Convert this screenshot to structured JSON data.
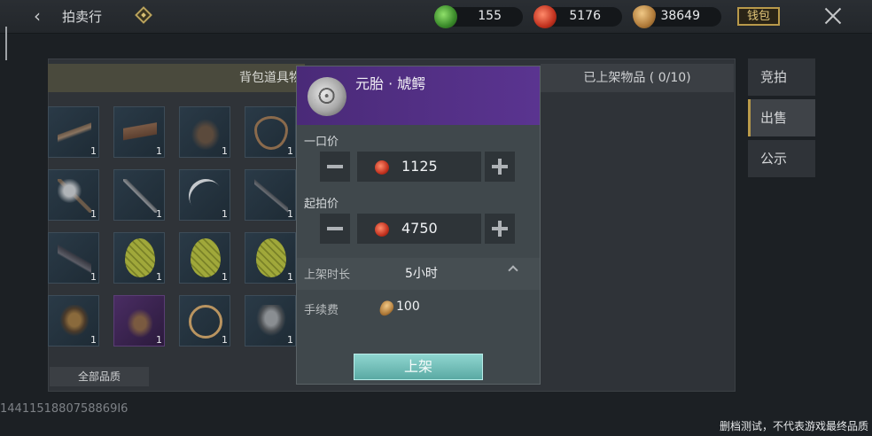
{
  "header": {
    "title": "拍卖行",
    "currencies": [
      {
        "icon": "green-currency-icon",
        "value": "155"
      },
      {
        "icon": "red-currency-icon",
        "value": "5176"
      },
      {
        "icon": "seed-currency-icon",
        "value": "38649"
      }
    ],
    "wallet_label": "钱包"
  },
  "tabs": {
    "bag": "背包道具物",
    "listed": "已上架物品 ( 0/10)"
  },
  "side_tabs": [
    "竞拍",
    "出售",
    "公示"
  ],
  "inventory": [
    {
      "name": "rifle",
      "qty": "1"
    },
    {
      "name": "crate",
      "qty": "1"
    },
    {
      "name": "figure",
      "qty": "1"
    },
    {
      "name": "rope",
      "qty": "1"
    },
    {
      "name": "axe",
      "qty": "1"
    },
    {
      "name": "spear",
      "qty": "1"
    },
    {
      "name": "scythe",
      "qty": "1"
    },
    {
      "name": "staff",
      "qty": "1"
    },
    {
      "name": "crossbow",
      "qty": "1"
    },
    {
      "name": "egg",
      "qty": "1"
    },
    {
      "name": "egg",
      "qty": "1"
    },
    {
      "name": "egg",
      "qty": "1"
    },
    {
      "name": "tribal",
      "qty": "1"
    },
    {
      "name": "horns",
      "qty": "1"
    },
    {
      "name": "ring",
      "qty": "1"
    },
    {
      "name": "helmet",
      "qty": "1"
    }
  ],
  "quality_filter": "全部品质",
  "uid": "1441151880758869I6",
  "disclaimer": "删档测试，不代表游戏最终品质",
  "popup": {
    "item_name": "元胎 · 虓鳄",
    "buyout_label": "一口价",
    "buyout_value": "1125",
    "start_label": "起拍价",
    "start_value": "4750",
    "duration_label": "上架时长",
    "duration_value": "5小时",
    "fee_label": "手续费",
    "fee_value": "100",
    "submit_label": "上架"
  },
  "colors": {
    "popup_header": "#4a2a78",
    "submit_button": "#7cc4be",
    "wallet_border": "#b99a4a"
  }
}
